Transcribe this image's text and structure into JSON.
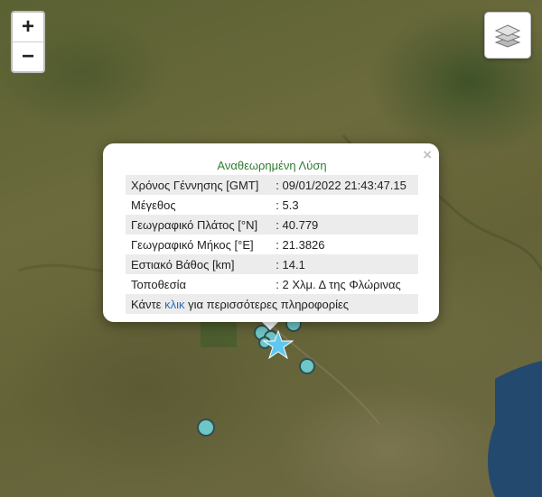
{
  "zoom": {
    "in_label": "+",
    "out_label": "−"
  },
  "layers_icon": "layers-icon",
  "popup": {
    "close_label": "×",
    "title": "Αναθεωρημένη Λύση",
    "rows": [
      {
        "label": "Χρόνος Γέννησης [GMT]",
        "value": ": 09/01/2022 21:43:47.15"
      },
      {
        "label": "Μέγεθος",
        "value": ": 5.3"
      },
      {
        "label": "Γεωγραφικό Πλάτος [°N]",
        "value": ": 40.779"
      },
      {
        "label": "Γεωγραφικό Μήκος [°E]",
        "value": ": 21.3826"
      },
      {
        "label": "Εστιακό Βάθος [km]",
        "value": ": 14.1"
      },
      {
        "label": "Τοποθεσία",
        "value": ": 2 Χλμ. Δ της Φλώρινας"
      }
    ],
    "footer_before": "Κάντε ",
    "footer_link": "κλικ",
    "footer_after": " για περισσότερες πληροφορίες"
  },
  "colors": {
    "marker_fill": "#6fc6c6",
    "star": "#5ec8f2",
    "title": "#2e7d32",
    "link": "#2a6fb6",
    "lake": "#24496e"
  }
}
